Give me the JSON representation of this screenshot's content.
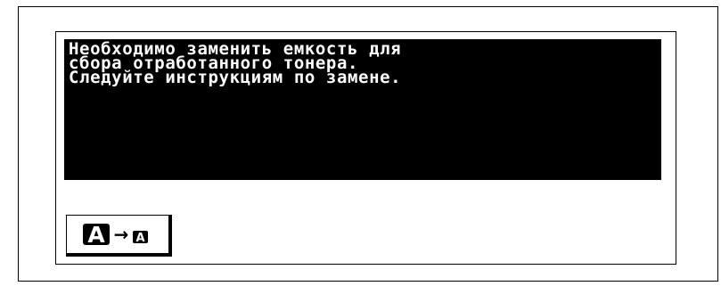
{
  "message": {
    "lines": [
      "Необходимо заменить емкость для",
      "сбора отработанного тонера.",
      "Следуйте инструкциям по замене."
    ]
  },
  "buttons": {
    "font_size_toggle": {
      "icon": "large-to-small-font-icon",
      "large_glyph": "A",
      "small_glyph": "A",
      "arrow_glyph": "→"
    }
  },
  "colors": {
    "background": "#ffffff",
    "message_background": "#000000",
    "message_text": "#ffffff",
    "border": "#000000"
  }
}
